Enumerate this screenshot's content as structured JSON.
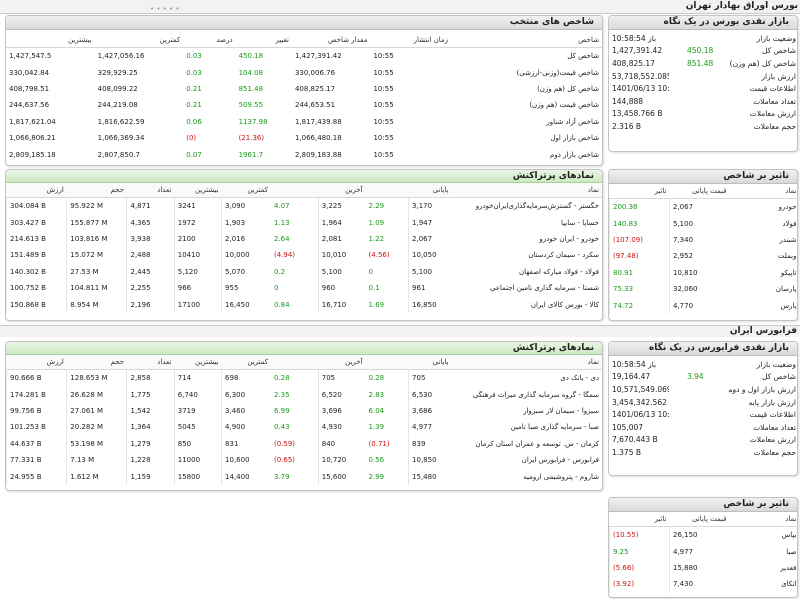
{
  "top_title": "بورس اوراق بهادار تهران",
  "ifb_section_title": "فرابورس ایران",
  "indices": {
    "title": "شاخص های منتخب",
    "headers": [
      "شاخص",
      "زمان انتشار",
      "مقدار شاخص",
      "تغییر",
      "درصد",
      "کمترین",
      "بیشترین"
    ],
    "rows": [
      {
        "name": "شاخص کل",
        "time": "10:55",
        "value": "1,427,391.42",
        "change": "450.18",
        "pct": "0.03",
        "min": "1,427,056.16",
        "max": "1,427,547.5",
        "sign": "pos"
      },
      {
        "name": "شاخص قیمت(وزنی-ارزشی)",
        "time": "10:55",
        "value": "330,006.76",
        "change": "104.08",
        "pct": "0.03",
        "min": "329,929.25",
        "max": "330,042.84",
        "sign": "pos"
      },
      {
        "name": "شاخص کل (هم وزن)",
        "time": "10:55",
        "value": "408,825.17",
        "change": "851.48",
        "pct": "0.21",
        "min": "408,099.22",
        "max": "408,798.51",
        "sign": "pos"
      },
      {
        "name": "شاخص قیمت (هم وزن)",
        "time": "10:55",
        "value": "244,653.51",
        "change": "509.55",
        "pct": "0.21",
        "min": "244,219.08",
        "max": "244,637.56",
        "sign": "pos"
      },
      {
        "name": "شاخص آزاد شناور",
        "time": "10:55",
        "value": "1,817,439.88",
        "change": "1137.98",
        "pct": "0.06",
        "min": "1,816,622.59",
        "max": "1,817,621.04",
        "sign": "pos"
      },
      {
        "name": "شاخص بازار اول",
        "time": "10:55",
        "value": "1,066,480.18",
        "change": "(21.36)",
        "pct": "(0)",
        "min": "1,066,369.34",
        "max": "1,066,806.21",
        "sign": "neg"
      },
      {
        "name": "شاخص بازار دوم",
        "time": "10:55",
        "value": "2,809,183.88",
        "change": "1961.7",
        "pct": "0.07",
        "min": "2,807,850.7",
        "max": "2,809,185.18",
        "sign": "pos"
      }
    ]
  },
  "tse_market": {
    "title": "بازار نقدی بورس در یک نگاه",
    "rows": [
      {
        "label": "وضعیت بازار",
        "value": "باز 10:58:54",
        "delta": ""
      },
      {
        "label": "شاخص کل",
        "value": "1,427,391.42",
        "delta": "450.18"
      },
      {
        "label": "شاخص کل (هم وزن)",
        "value": "408,825.17",
        "delta": "851.48"
      },
      {
        "label": "ارزش بازار",
        "value": "53,718,552.085 B",
        "delta": ""
      },
      {
        "label": "اطلاعات قیمت",
        "value": "1401/06/13 10:58:44",
        "delta": ""
      },
      {
        "label": "تعداد معاملات",
        "value": "144,888",
        "delta": ""
      },
      {
        "label": "ارزش معاملات",
        "value": "13,458.766 B",
        "delta": ""
      },
      {
        "label": "حجم معاملات",
        "value": "2.316 B",
        "delta": ""
      }
    ]
  },
  "tse_trades": {
    "title": "نمادهای پرتراکنش",
    "headers": [
      "نماد",
      "پایانی",
      "",
      "آخرین",
      "",
      "کمترین",
      "بیشترین",
      "تعداد",
      "حجم",
      "ارزش"
    ],
    "rows": [
      {
        "name": "خگستر - گسترش‌سرمایه‌گذاری‌ایران‌خودرو",
        "close": "3,170",
        "close_chg": "2.29",
        "close_sign": "pos",
        "last": "3,225",
        "last_chg": "4.07",
        "last_sign": "pos",
        "min": "3,090",
        "max": "3241",
        "count": "4,871",
        "volume": "95.922 M",
        "value": "304.084 B"
      },
      {
        "name": "خساپا - سایپا",
        "close": "1,947",
        "close_chg": "1.09",
        "close_sign": "pos",
        "last": "1,964",
        "last_chg": "1.13",
        "last_sign": "pos",
        "min": "1,903",
        "max": "1972",
        "count": "4,365",
        "volume": "155.877 M",
        "value": "303.427 B"
      },
      {
        "name": "خودرو - ایران‌ خودرو",
        "close": "2,067",
        "close_chg": "1.22",
        "close_sign": "pos",
        "last": "2,081",
        "last_chg": "2.64",
        "last_sign": "pos",
        "min": "2,016",
        "max": "2100",
        "count": "3,938",
        "volume": "103.816 M",
        "value": "214.613 B"
      },
      {
        "name": "سکرد - سیمان کردستان",
        "close": "10,050",
        "close_chg": "(4.56)",
        "close_sign": "neg",
        "last": "10,010",
        "last_chg": "(4.94)",
        "last_sign": "neg",
        "min": "10,000",
        "max": "10410",
        "count": "2,488",
        "volume": "15.072 M",
        "value": "151.489 B"
      },
      {
        "name": "فولاد - فولاد مبارکه اصفهان",
        "close": "5,100",
        "close_chg": "0",
        "close_sign": "pos",
        "last": "5,100",
        "last_chg": "0.2",
        "last_sign": "pos",
        "min": "5,070",
        "max": "5,120",
        "count": "2,445",
        "volume": "27.53 M",
        "value": "140.302 B"
      },
      {
        "name": "شستا - سرمایه گذاری تامین اجتماعی",
        "close": "961",
        "close_chg": "0.1",
        "close_sign": "pos",
        "last": "960",
        "last_chg": "0",
        "last_sign": "pos",
        "min": "955",
        "max": "966",
        "count": "2,255",
        "volume": "104.811 M",
        "value": "100.752 B"
      },
      {
        "name": "کالا - بورس کالای ایران",
        "close": "16,850",
        "close_chg": "1.69",
        "close_sign": "pos",
        "last": "16,710",
        "last_chg": "0.84",
        "last_sign": "pos",
        "min": "16,450",
        "max": "17100",
        "count": "2,196",
        "volume": "8.954 M",
        "value": "150.868 B"
      }
    ]
  },
  "tse_impact": {
    "title": "تاثیر بر شاخص",
    "headers": [
      "نماد",
      "قیمت پایانی",
      "تاثیر"
    ],
    "rows": [
      {
        "name": "خودرو",
        "price": "2,067",
        "impact": "200.38",
        "sign": "pos"
      },
      {
        "name": "فولاد",
        "price": "5,100",
        "impact": "140.83",
        "sign": "pos"
      },
      {
        "name": "شبندر",
        "price": "7,340",
        "impact": "(107.09)",
        "sign": "neg"
      },
      {
        "name": "وبملت",
        "price": "2,952",
        "impact": "(97.48)",
        "sign": "neg"
      },
      {
        "name": "تاپیکو",
        "price": "10,810",
        "impact": "80.91",
        "sign": "pos"
      },
      {
        "name": "پارسان",
        "price": "32,060",
        "impact": "75.33",
        "sign": "pos"
      },
      {
        "name": "پارس",
        "price": "4,770",
        "impact": "74.72",
        "sign": "pos"
      }
    ]
  },
  "ifb_market": {
    "title": "بازار نقدی فرابورس در یک نگاه",
    "rows": [
      {
        "label": "وضعیت بازار",
        "value": "باز 10:58:54",
        "delta": ""
      },
      {
        "label": "شاخص کل",
        "value": "19,164.47",
        "delta": "3.94"
      },
      {
        "label": "ارزش بازار اول و دوم",
        "value": "10,571,549.069 B",
        "delta": ""
      },
      {
        "label": "ارزش بازار پایه",
        "value": "3,454,342.562 B",
        "delta": ""
      },
      {
        "label": "اطلاعات قیمت",
        "value": "1401/06/13 10:58:46",
        "delta": ""
      },
      {
        "label": "تعداد معاملات",
        "value": "105,007",
        "delta": ""
      },
      {
        "label": "ارزش معاملات",
        "value": "7,670.443 B",
        "delta": ""
      },
      {
        "label": "حجم معاملات",
        "value": "1.375 B",
        "delta": ""
      }
    ]
  },
  "ifb_trades": {
    "title": "نمادهای پرتراکنش",
    "headers": [
      "نماد",
      "پایانی",
      "",
      "آخرین",
      "",
      "کمترین",
      "بیشترین",
      "تعداد",
      "حجم",
      "ارزش"
    ],
    "rows": [
      {
        "name": "دی - بانک دی",
        "close": "705",
        "close_chg": "0.28",
        "close_sign": "pos",
        "last": "705",
        "last_chg": "0.28",
        "last_sign": "pos",
        "min": "698",
        "max": "714",
        "count": "2,858",
        "volume": "128.653 M",
        "value": "90.666 B"
      },
      {
        "name": "سمگا - گروه سرمایه گذاری میراث فرهنگی",
        "close": "6,530",
        "close_chg": "2.83",
        "close_sign": "pos",
        "last": "6,520",
        "last_chg": "2.35",
        "last_sign": "pos",
        "min": "6,300",
        "max": "6,740",
        "count": "1,775",
        "volume": "26.628 M",
        "value": "174.281 B"
      },
      {
        "name": "سیزوا - سیمان لار سبزوار",
        "close": "3,686",
        "close_chg": "6.04",
        "close_sign": "pos",
        "last": "3,696",
        "last_chg": "6.99",
        "last_sign": "pos",
        "min": "3,460",
        "max": "3719",
        "count": "1,542",
        "volume": "27.061 M",
        "value": "99.756 B"
      },
      {
        "name": "صبا - سرمایه گذاری صبا تامین",
        "close": "4,977",
        "close_chg": "1.39",
        "close_sign": "pos",
        "last": "4,930",
        "last_chg": "0.43",
        "last_sign": "pos",
        "min": "4,900",
        "max": "5045",
        "count": "1,364",
        "volume": "20.282 M",
        "value": "101.253 B"
      },
      {
        "name": "کرمان - س. توسعه و عمران استان کرمان",
        "close": "839",
        "close_chg": "(0.71)",
        "close_sign": "neg",
        "last": "840",
        "last_chg": "(0.59)",
        "last_sign": "neg",
        "min": "831",
        "max": "850",
        "count": "1,279",
        "volume": "53.198 M",
        "value": "44.637 B"
      },
      {
        "name": "فرابورس - فرابورس ایران",
        "close": "10,850",
        "close_chg": "0.56",
        "close_sign": "pos",
        "last": "10,720",
        "last_chg": "(0.65)",
        "last_sign": "neg",
        "min": "10,600",
        "max": "11000",
        "count": "1,228",
        "volume": "7.13 M",
        "value": "77.331 B"
      },
      {
        "name": "شاروم - پتروشیمی ارومیه",
        "close": "15,480",
        "close_chg": "2.99",
        "close_sign": "pos",
        "last": "15,600",
        "last_chg": "3.79",
        "last_sign": "pos",
        "min": "14,400",
        "max": "15800",
        "count": "1,159",
        "volume": "1.612 M",
        "value": "24.955 B"
      }
    ]
  },
  "ifb_impact": {
    "title": "تاثیر بر شاخص",
    "headers": [
      "نماد",
      "قیمت پایانی",
      "تاثیر"
    ],
    "rows": [
      {
        "name": "بپاس",
        "price": "26,150",
        "impact": "(10.55)",
        "sign": "neg"
      },
      {
        "name": "صبا",
        "price": "4,977",
        "impact": "9.25",
        "sign": "pos"
      },
      {
        "name": "فغدیر",
        "price": "15,880",
        "impact": "(5.66)",
        "sign": "neg"
      },
      {
        "name": "اتکای",
        "price": "7,430",
        "impact": "(3.92)",
        "sign": "neg"
      }
    ]
  }
}
